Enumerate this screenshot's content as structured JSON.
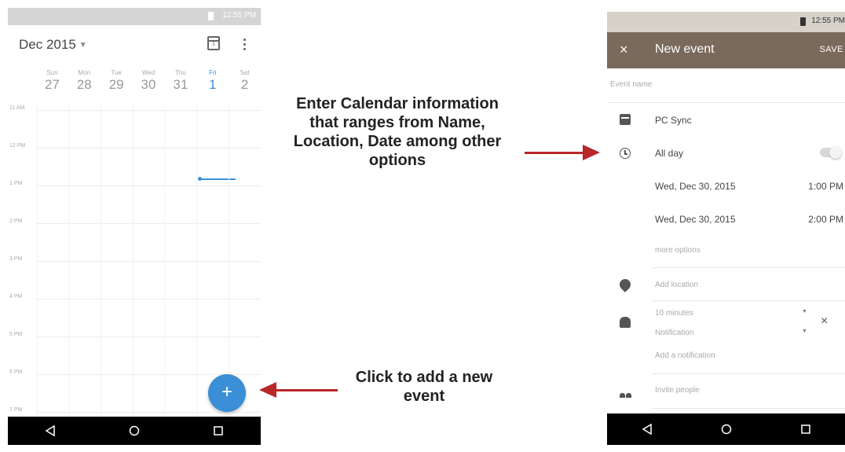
{
  "calendar_screen": {
    "status_time": "12:55 PM",
    "month_label": "Dec 2015",
    "today_icon_number": "1",
    "week": [
      {
        "name": "Sun",
        "date": "27",
        "today": false
      },
      {
        "name": "Mon",
        "date": "28",
        "today": false
      },
      {
        "name": "Tue",
        "date": "29",
        "today": false
      },
      {
        "name": "Wed",
        "date": "30",
        "today": false
      },
      {
        "name": "Thu",
        "date": "31",
        "today": false
      },
      {
        "name": "Fri",
        "date": "1",
        "today": true
      },
      {
        "name": "Sat",
        "date": "2",
        "today": false
      }
    ],
    "hours": [
      "11 AM",
      "12 PM",
      "1 PM",
      "2 PM",
      "3 PM",
      "4 PM",
      "5 PM",
      "6 PM",
      "7 PM"
    ],
    "fab_label": "+",
    "accent_color": "#3a8fd6"
  },
  "new_event_screen": {
    "status_time": "12:55 PM",
    "toolbar_color": "#7a6a5c",
    "close_label": "×",
    "title": "New event",
    "save_label": "SAVE",
    "event_name_placeholder": "Event name",
    "calendar_name": "PC Sync",
    "all_day_label": "All day",
    "start_date": "Wed, Dec 30, 2015",
    "start_time": "1:00 PM",
    "end_date": "Wed, Dec 30, 2015",
    "end_time": "2:00 PM",
    "more_options": "more options",
    "location_placeholder": "Add location",
    "notification_time": "10 minutes",
    "notification_type": "Notification",
    "remove_notification": "×",
    "add_notification": "Add a notification",
    "invite_people": "Invite people"
  },
  "annotations": {
    "callout_details": "Enter Calendar information that ranges from Name, Location, Date among other options",
    "callout_add": "Click to add a new event",
    "arrow_color": "#b8272a"
  }
}
